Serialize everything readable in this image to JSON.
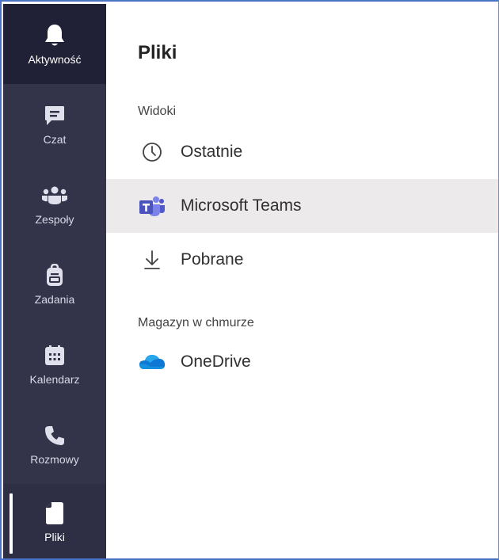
{
  "rail": {
    "items": [
      {
        "label": "Aktywność",
        "icon": "bell-icon"
      },
      {
        "label": "Czat",
        "icon": "chat-icon"
      },
      {
        "label": "Zespoły",
        "icon": "teams-icon"
      },
      {
        "label": "Zadania",
        "icon": "assignments-icon"
      },
      {
        "label": "Kalendarz",
        "icon": "calendar-icon"
      },
      {
        "label": "Rozmowy",
        "icon": "phone-icon"
      },
      {
        "label": "Pliki",
        "icon": "file-icon"
      }
    ]
  },
  "main": {
    "title": "Pliki",
    "views_header": "Widoki",
    "views": [
      {
        "label": "Ostatnie",
        "icon": "clock-icon"
      },
      {
        "label": "Microsoft Teams",
        "icon": "microsoft-teams-icon"
      },
      {
        "label": "Pobrane",
        "icon": "download-icon"
      }
    ],
    "cloud_header": "Magazyn w chmurze",
    "cloud": [
      {
        "label": "OneDrive",
        "icon": "onedrive-icon"
      }
    ]
  },
  "colors": {
    "rail_bg": "#33344a",
    "highlight_bg": "#eceaea",
    "teams_purple": "#5b5fc7",
    "onedrive_blue": "#0f78d4"
  }
}
